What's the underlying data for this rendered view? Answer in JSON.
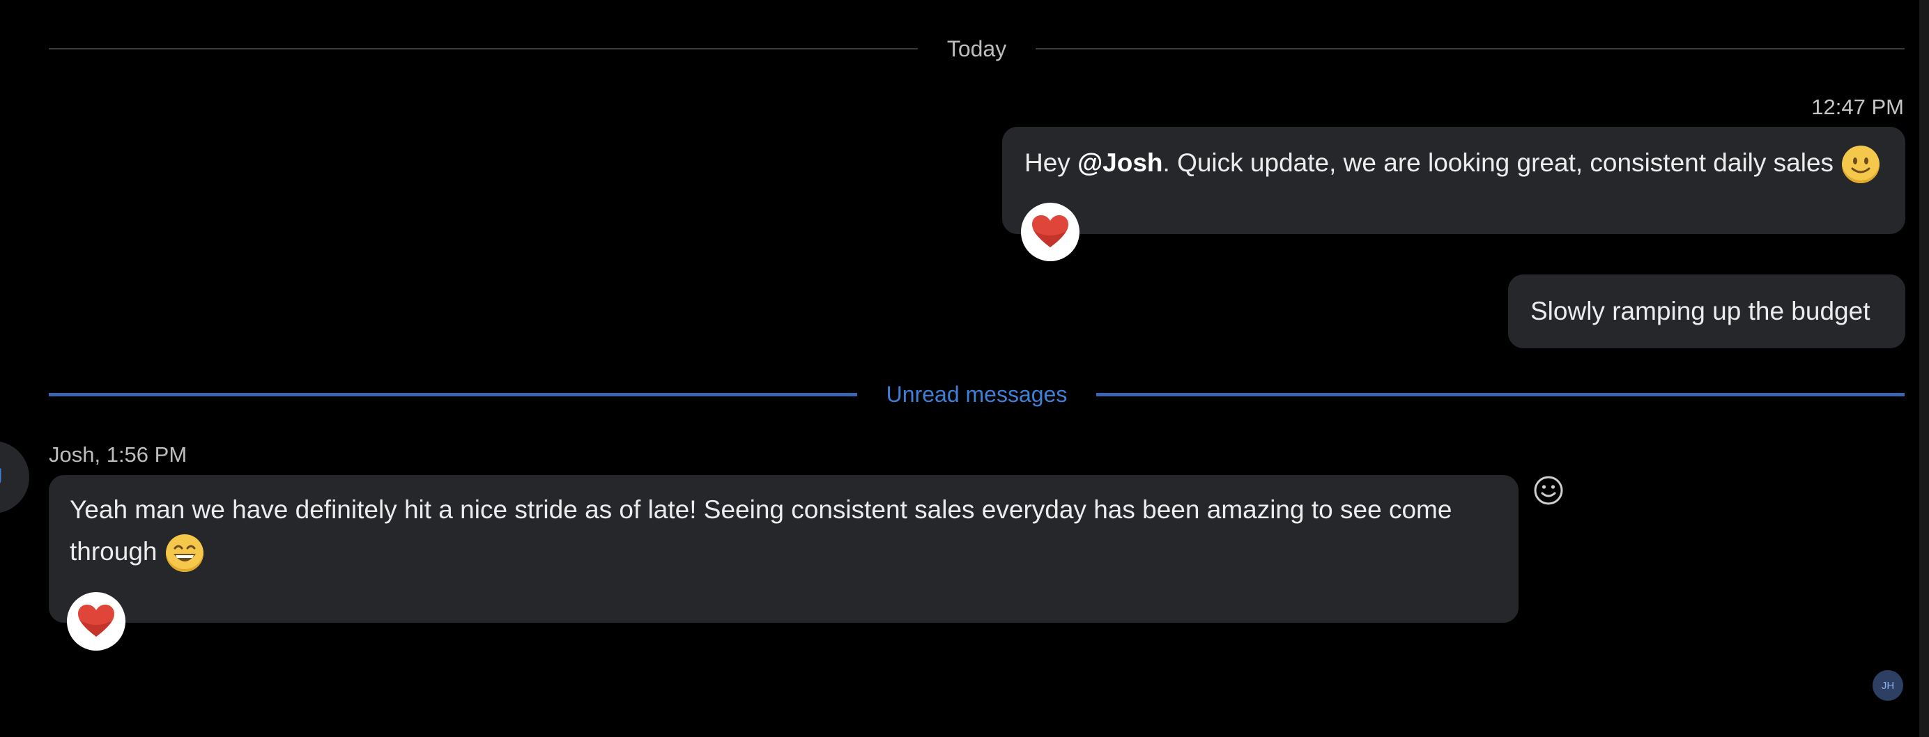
{
  "dividers": {
    "date_label": "Today",
    "unread_label": "Unread messages"
  },
  "messages": [
    {
      "direction": "outgoing",
      "timestamp": "12:47 PM",
      "text_before": "Hey ",
      "mention": "@Josh",
      "text_after": ". Quick update, we are looking great, consistent daily sales",
      "emoji": "slightly-smiling-face-icon",
      "reaction": "heart-icon"
    },
    {
      "direction": "outgoing",
      "text": "Slowly ramping up the budget"
    },
    {
      "direction": "incoming",
      "sender": "Josh, 1:56 PM",
      "avatar_letter": "J",
      "text": "Yeah man we have definitely hit a nice stride as of late! Seeing consistent sales everyday has been amazing to see come through",
      "emoji": "grinning-face-icon",
      "reaction": "heart-icon"
    }
  ],
  "read_receipt": {
    "initials": "JH"
  },
  "colors": {
    "background": "#000000",
    "bubble": "#25272b",
    "unread_accent": "#3f7fd8",
    "heart": "#e0453a"
  }
}
